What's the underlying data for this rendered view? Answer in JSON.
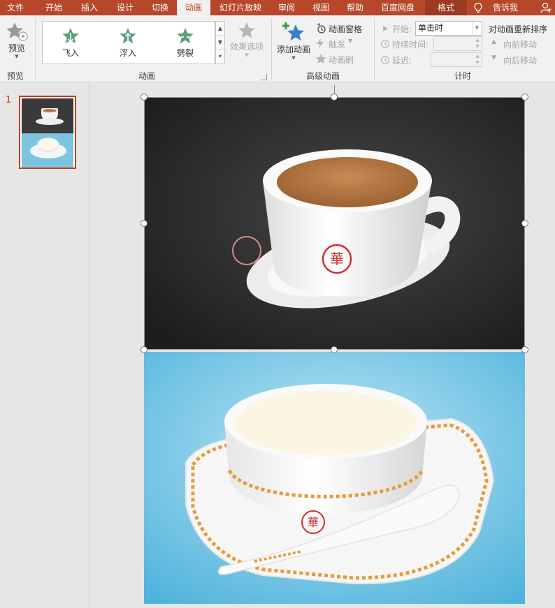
{
  "tabs": [
    {
      "label": "文件"
    },
    {
      "label": "开始"
    },
    {
      "label": "插入"
    },
    {
      "label": "设计"
    },
    {
      "label": "切换"
    },
    {
      "label": "动画"
    },
    {
      "label": "幻灯片放映"
    },
    {
      "label": "审阅"
    },
    {
      "label": "视图"
    },
    {
      "label": "帮助"
    },
    {
      "label": "百度网盘"
    },
    {
      "label": "格式"
    }
  ],
  "tell_me": "告诉我",
  "ribbon": {
    "preview": {
      "button_label": "预览",
      "group_label": "预览"
    },
    "animation": {
      "effects": [
        {
          "label": "飞入"
        },
        {
          "label": "浮入"
        },
        {
          "label": "劈裂"
        }
      ],
      "effect_options_label": "效果选项",
      "group_label": "动画"
    },
    "advanced": {
      "add_animation_label": "添加动画",
      "animation_pane_label": "动画窗格",
      "trigger_label": "触发",
      "animation_painter_label": "动画刷",
      "group_label": "高级动画"
    },
    "timing": {
      "start_label": "开始:",
      "start_value": "单击时",
      "duration_label": "持续时间:",
      "delay_label": "延迟:",
      "reorder_label": "对动画重新排序",
      "move_earlier_label": "向前移动",
      "move_later_label": "向后移动",
      "group_label": "计时"
    }
  },
  "slides": [
    {
      "number": "1"
    }
  ],
  "colors": {
    "accent": "#b7472a",
    "ribbon_bg": "#f1f1f1",
    "workspace_bg": "#e6e6e6",
    "star_green": "#5aa07c"
  }
}
